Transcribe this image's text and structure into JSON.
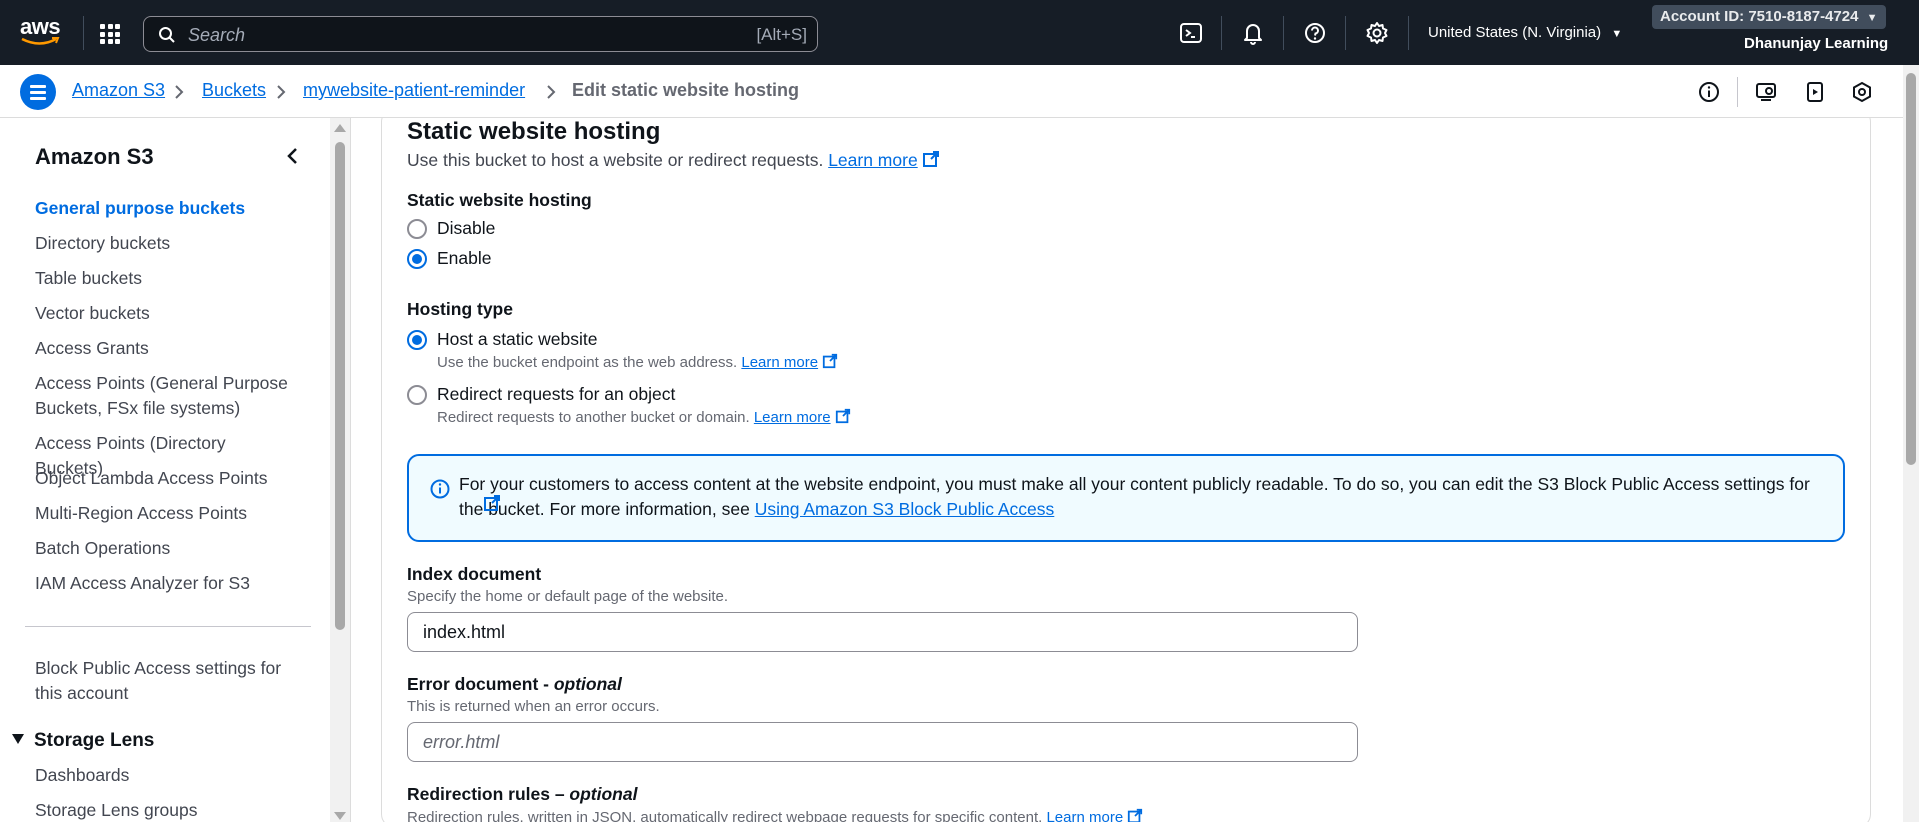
{
  "topnav": {
    "logo_text": "aws",
    "search_placeholder": "Search",
    "search_shortcut": "[Alt+S]",
    "region": "United States (N. Virginia)",
    "account": "Account ID: 7510-8187-4724",
    "user": "Dhanunjay Learning",
    "icons": [
      "cloudshell-icon",
      "bell-icon",
      "help-icon",
      "gear-icon"
    ]
  },
  "breadcrumb": {
    "items": [
      "Amazon S3",
      "Buckets",
      "mywebsite-patient-reminder"
    ],
    "current": "Edit static website hosting"
  },
  "sidenav": {
    "title": "Amazon S3",
    "items": [
      "General purpose buckets",
      "Directory buckets",
      "Table buckets",
      "Vector buckets",
      "Access Grants",
      "Access Points (General Purpose Buckets, FSx file systems)",
      "Access Points (Directory Buckets)",
      "Object Lambda Access Points",
      "Multi-Region Access Points",
      "Batch Operations",
      "IAM Access Analyzer for S3"
    ],
    "active_index": 0,
    "block_public_access": "Block Public Access settings for this account",
    "section": "Storage Lens",
    "section_items": [
      "Dashboards",
      "Storage Lens groups"
    ]
  },
  "main": {
    "title": "Static website hosting",
    "description": "Use this bucket to host a website or redirect requests.",
    "learn_more": "Learn more",
    "hosting": {
      "label": "Static website hosting",
      "options": [
        "Disable",
        "Enable"
      ],
      "selected": "Enable"
    },
    "hosting_type": {
      "label": "Hosting type",
      "options": [
        {
          "label": "Host a static website",
          "sub": "Use the bucket endpoint as the web address."
        },
        {
          "label": "Redirect requests for an object",
          "sub": "Redirect requests to another bucket or domain."
        }
      ],
      "selected": "Host a static website"
    },
    "alert": {
      "text": "For your customers to access content at the website endpoint, you must make all your content publicly readable. To do so, you can edit the S3 Block Public Access settings for the bucket. For more information, see",
      "link": "Using Amazon S3 Block Public Access"
    },
    "index_document": {
      "label": "Index document",
      "hint": "Specify the home or default page of the website.",
      "value": "index.html"
    },
    "error_document": {
      "label": "Error document - ",
      "label_optional": "optional",
      "hint": "This is returned when an error occurs.",
      "placeholder": "error.html"
    },
    "redirection_rules": {
      "label": "Redirection rules – ",
      "label_optional": "optional",
      "hint": "Redirection rules, written in JSON, automatically redirect webpage requests for specific content."
    }
  }
}
